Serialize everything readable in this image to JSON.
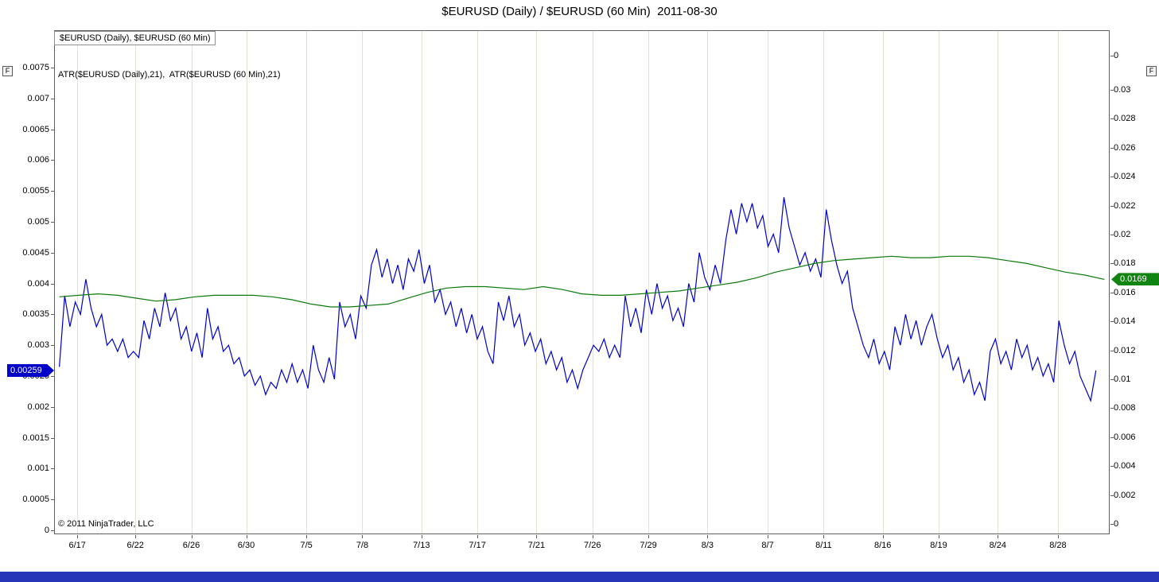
{
  "window": {
    "title": "$EURUSD (Daily) / $EURUSD (60 Min)  2011-08-30"
  },
  "panels": {
    "price_label": "$EURUSD (Daily), $EURUSD (60 Min)",
    "indicator_label": "ATR($EURUSD (Daily),21),  ATR($EURUSD (60 Min),21)",
    "focus_button_label": "F",
    "copyright": "© 2011 NinjaTrader, LLC"
  },
  "markers": {
    "blue": {
      "label": "0.00259",
      "value": 0.00259,
      "color": "#0000c8"
    },
    "green": {
      "label": "0.0169",
      "value": 0.0169,
      "color": "#128412"
    }
  },
  "colors": {
    "bottom_bar": "#2736b8"
  },
  "chart_data": {
    "type": "line",
    "title": "$EURUSD (Daily) / $EURUSD (60 Min)  2011-08-30",
    "x_ticks": [
      {
        "label": "6/17",
        "pos": 0.022
      },
      {
        "label": "6/22",
        "pos": 0.077
      },
      {
        "label": "6/26",
        "pos": 0.13
      },
      {
        "label": "6/30",
        "pos": 0.182
      },
      {
        "label": "7/5",
        "pos": 0.239
      },
      {
        "label": "7/8",
        "pos": 0.292
      },
      {
        "label": "7/13",
        "pos": 0.348
      },
      {
        "label": "7/17",
        "pos": 0.401
      },
      {
        "label": "7/21",
        "pos": 0.457
      },
      {
        "label": "7/26",
        "pos": 0.51
      },
      {
        "label": "7/29",
        "pos": 0.563
      },
      {
        "label": "8/3",
        "pos": 0.619
      },
      {
        "label": "8/7",
        "pos": 0.676
      },
      {
        "label": "8/11",
        "pos": 0.729
      },
      {
        "label": "8/16",
        "pos": 0.785
      },
      {
        "label": "8/19",
        "pos": 0.838
      },
      {
        "label": "8/24",
        "pos": 0.894
      },
      {
        "label": "8/28",
        "pos": 0.951
      }
    ],
    "left_axis": {
      "min": 0,
      "max": 0.0075,
      "ticks": [
        "0.0075",
        "0.007",
        "0.0065",
        "0.006",
        "0.0055",
        "0.005",
        "0.0045",
        "0.004",
        "0.0035",
        "0.003",
        "0.0025",
        "0.002",
        "0.0015",
        "0.001",
        "0.0005",
        "0"
      ]
    },
    "right_axis": {
      "min": 0,
      "max": 0.03,
      "ticks": [
        "0.03",
        "0.028",
        "0.026",
        "0.024",
        "0.022",
        "0.02",
        "0.018",
        "0.016",
        "0.014",
        "0.012",
        "0.01",
        "0.008",
        "0.006",
        "0.004",
        "0.002",
        "0"
      ]
    },
    "price_panel_axis_label": "0",
    "colors": {
      "grid": "#e4e1d7",
      "border": "#5e5e5e"
    },
    "series": [
      {
        "name": "ATR($EURUSD (60 Min),21)",
        "data_name": "atr-60min-line",
        "axis": "left",
        "color": "#0000cc",
        "x_start": 0.005,
        "x_end": 0.987,
        "current_value": 0.00259,
        "values": [
          0.00265,
          0.0038,
          0.0033,
          0.0037,
          0.0035,
          0.00407,
          0.0036,
          0.0033,
          0.0035,
          0.003,
          0.0031,
          0.0029,
          0.0031,
          0.0028,
          0.0029,
          0.0028,
          0.0034,
          0.0031,
          0.0036,
          0.0033,
          0.00385,
          0.0034,
          0.0036,
          0.0031,
          0.0033,
          0.0029,
          0.0032,
          0.0028,
          0.0036,
          0.0031,
          0.0033,
          0.0029,
          0.003,
          0.0027,
          0.0028,
          0.0025,
          0.0026,
          0.00235,
          0.0025,
          0.0022,
          0.0024,
          0.0023,
          0.0026,
          0.0024,
          0.0027,
          0.0024,
          0.0026,
          0.0023,
          0.003,
          0.0026,
          0.0024,
          0.0028,
          0.00245,
          0.0037,
          0.0033,
          0.0035,
          0.0031,
          0.0038,
          0.0036,
          0.0043,
          0.00455,
          0.0041,
          0.0044,
          0.004,
          0.0043,
          0.0039,
          0.0044,
          0.0042,
          0.00455,
          0.004,
          0.0043,
          0.0037,
          0.0039,
          0.0035,
          0.0037,
          0.0033,
          0.0036,
          0.0032,
          0.0035,
          0.0031,
          0.0033,
          0.0029,
          0.0027,
          0.0037,
          0.0034,
          0.0038,
          0.0033,
          0.0035,
          0.003,
          0.0032,
          0.0029,
          0.0031,
          0.0027,
          0.0029,
          0.0026,
          0.0028,
          0.0024,
          0.0026,
          0.0023,
          0.0026,
          0.0028,
          0.003,
          0.0029,
          0.0031,
          0.0028,
          0.003,
          0.0028,
          0.0038,
          0.0033,
          0.0036,
          0.0032,
          0.0039,
          0.0035,
          0.004,
          0.0036,
          0.0038,
          0.0034,
          0.0036,
          0.0033,
          0.004,
          0.0037,
          0.0045,
          0.0041,
          0.0039,
          0.0043,
          0.004,
          0.0047,
          0.0052,
          0.0048,
          0.0053,
          0.005,
          0.0053,
          0.0049,
          0.0051,
          0.0046,
          0.0048,
          0.0045,
          0.0054,
          0.0049,
          0.0046,
          0.0043,
          0.0045,
          0.0042,
          0.0044,
          0.0041,
          0.0052,
          0.0047,
          0.0043,
          0.004,
          0.0042,
          0.0036,
          0.0033,
          0.003,
          0.0028,
          0.0031,
          0.0027,
          0.0029,
          0.0026,
          0.0033,
          0.003,
          0.0035,
          0.0031,
          0.0034,
          0.003,
          0.0033,
          0.0035,
          0.0031,
          0.0028,
          0.003,
          0.0026,
          0.0028,
          0.0024,
          0.0026,
          0.0022,
          0.0024,
          0.0021,
          0.0029,
          0.0031,
          0.0027,
          0.0029,
          0.0026,
          0.0031,
          0.0028,
          0.003,
          0.0026,
          0.0028,
          0.0025,
          0.0027,
          0.0024,
          0.0034,
          0.003,
          0.0027,
          0.0029,
          0.0025,
          0.0023,
          0.0021,
          0.00259
        ]
      },
      {
        "name": "ATR($EURUSD (Daily),21)",
        "data_name": "atr-daily-line",
        "axis": "right",
        "color": "#0b7a0b",
        "x_start": 0.005,
        "x_end": 0.995,
        "current_value": 0.0169,
        "values": [
          0.0157,
          0.0158,
          0.0159,
          0.0158,
          0.0156,
          0.0154,
          0.0155,
          0.0157,
          0.0158,
          0.0158,
          0.0158,
          0.0157,
          0.0155,
          0.0152,
          0.015,
          0.015,
          0.0151,
          0.0152,
          0.0156,
          0.016,
          0.0163,
          0.0164,
          0.0164,
          0.0163,
          0.0162,
          0.0164,
          0.0162,
          0.0159,
          0.0158,
          0.0158,
          0.0159,
          0.016,
          0.0161,
          0.0163,
          0.0165,
          0.0167,
          0.017,
          0.0174,
          0.0177,
          0.018,
          0.0182,
          0.0183,
          0.0184,
          0.0185,
          0.0184,
          0.0184,
          0.0185,
          0.0185,
          0.0184,
          0.0182,
          0.018,
          0.0177,
          0.0174,
          0.0172,
          0.0169
        ]
      }
    ]
  }
}
